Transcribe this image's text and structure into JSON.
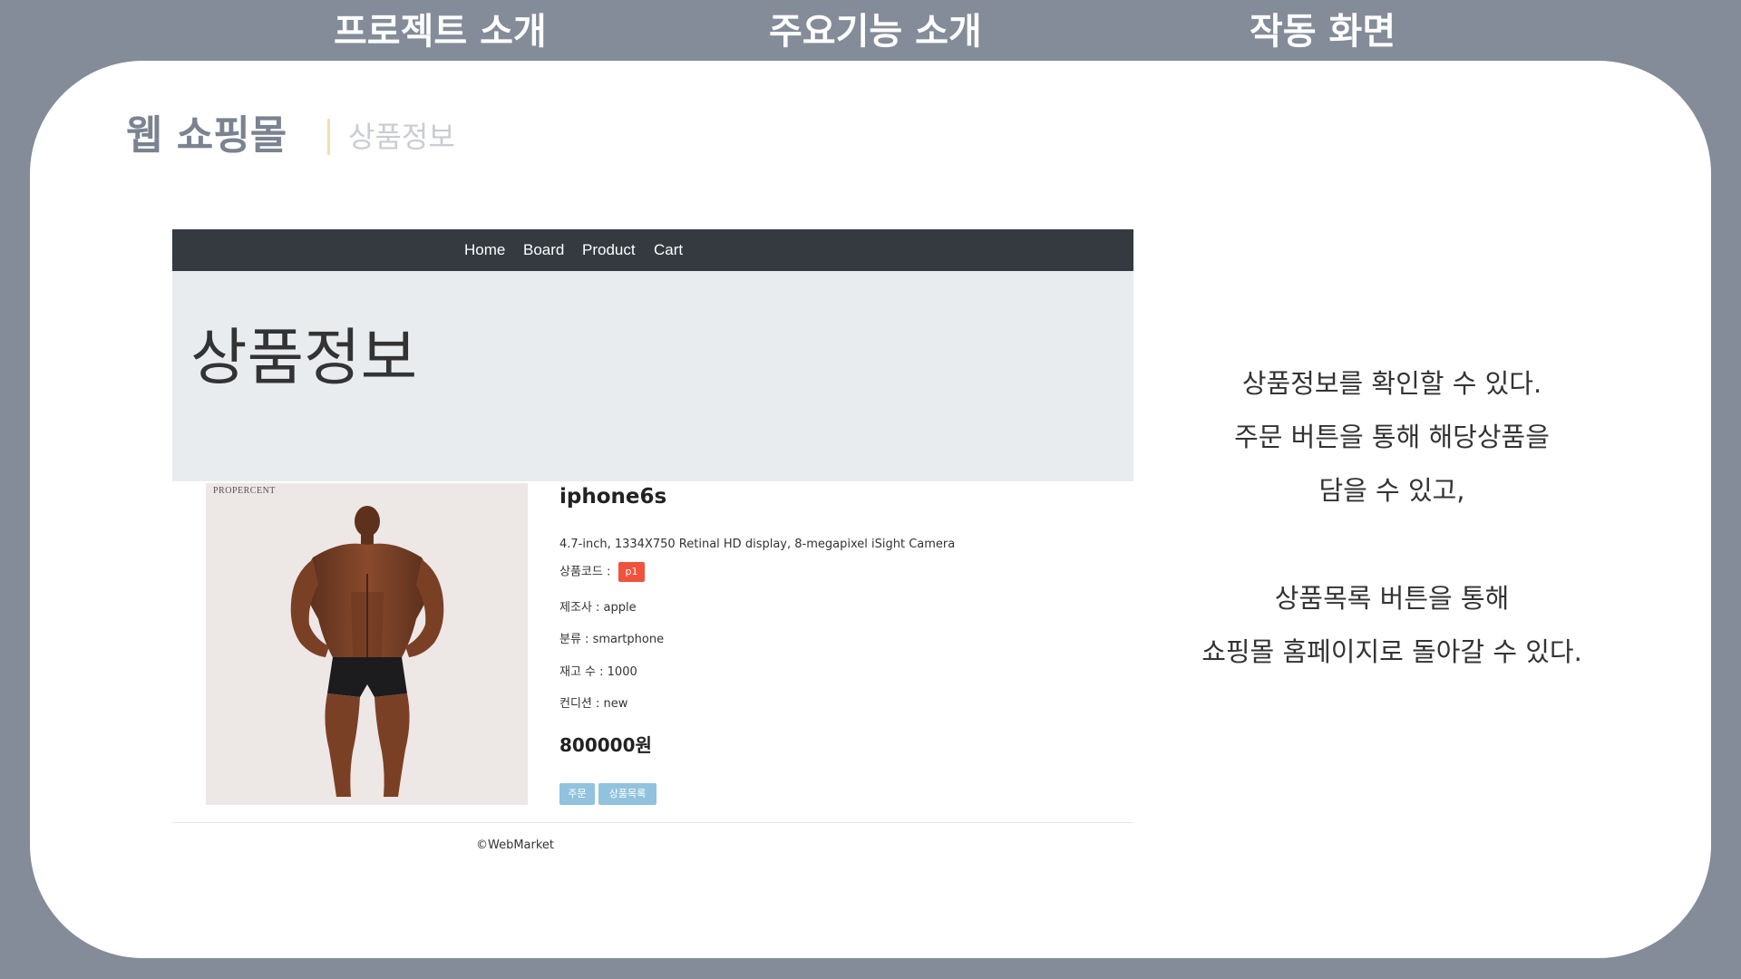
{
  "top_tabs": [
    "프로젝트 소개",
    "주요기능 소개",
    "작동 화면"
  ],
  "slide": {
    "title": "웹 쇼핑몰",
    "subtitle": "상품정보"
  },
  "screenshot": {
    "nav": [
      "Home",
      "Board",
      "Product",
      "Cart"
    ],
    "jumbotron_title": "상품정보",
    "photo_brand": "PROPERCENT",
    "product": {
      "name": "iphone6s",
      "description": "4.7-inch, 1334X750 Retinal HD display, 8-megapixel iSight Camera",
      "code_label": "상품코드 :",
      "code": "p1",
      "manufacturer": "제조사 : apple",
      "category": "분류 : smartphone",
      "stock": "재고 수 : 1000",
      "condition": "컨디션 : new",
      "price": "800000원"
    },
    "buttons": {
      "order": "주문",
      "list": "상품목록"
    },
    "footer": "©WebMarket"
  },
  "description_lines": [
    "상품정보를 확인할 수 있다.",
    "주문 버튼을 통해 해당상품을",
    "담을 수 있고,",
    "상품목록 버튼을 통해",
    "쇼핑몰 홈페이지로 돌아갈 수 있다."
  ],
  "colors": {
    "background": "#838c98",
    "card": "#ffffff",
    "navbar": "#343a40",
    "jumbotron": "#e9ecef",
    "badge": "#f0533b",
    "button": "#91c3de",
    "title_accent": "#f5dfa8"
  }
}
